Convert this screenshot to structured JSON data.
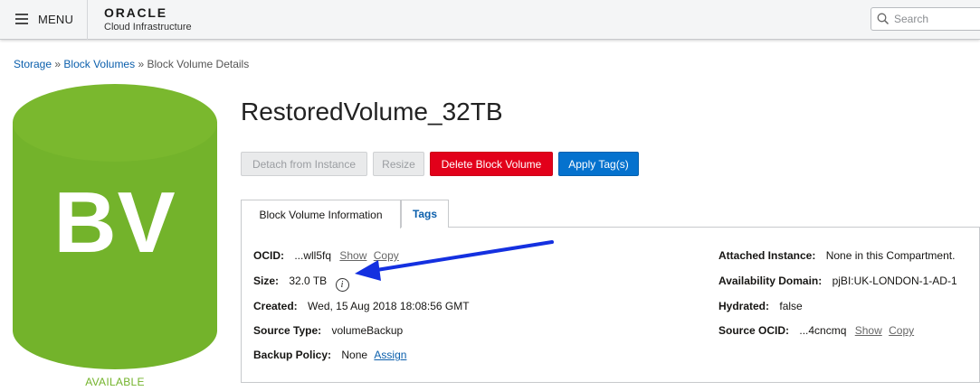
{
  "header": {
    "menu_label": "MENU",
    "brand": "ORACLE",
    "brand_sub": "Cloud Infrastructure",
    "search_placeholder": "Search"
  },
  "breadcrumb": {
    "items": [
      "Storage",
      "Block Volumes",
      "Block Volume Details"
    ],
    "separator": "»"
  },
  "resource": {
    "icon_text": "BV",
    "status": "AVAILABLE",
    "status_color": "#73b32b",
    "name": "RestoredVolume_32TB"
  },
  "actions": {
    "detach": "Detach from Instance",
    "resize": "Resize",
    "delete": "Delete Block Volume",
    "apply_tags": "Apply Tag(s)"
  },
  "tabs": {
    "info": "Block Volume Information",
    "tags": "Tags"
  },
  "details": {
    "ocid_label": "OCID:",
    "ocid_value": "...wll5fq",
    "show": "Show",
    "copy": "Copy",
    "size_label": "Size:",
    "size_value": "32.0 TB",
    "info_glyph": "i",
    "created_label": "Created:",
    "created_value": "Wed, 15 Aug 2018 18:08:56 GMT",
    "source_type_label": "Source Type:",
    "source_type_value": "volumeBackup",
    "backup_policy_label": "Backup Policy:",
    "backup_policy_value": "None",
    "assign": "Assign",
    "attached_label": "Attached Instance:",
    "attached_value": "None in this Compartment.",
    "ad_label": "Availability Domain:",
    "ad_value": "pjBI:UK-LONDON-1-AD-1",
    "hydrated_label": "Hydrated:",
    "hydrated_value": "false",
    "source_ocid_label": "Source OCID:",
    "source_ocid_value": "...4cncmq"
  },
  "colors": {
    "accent_blue": "#0572ce",
    "danger_red": "#e2001a",
    "volume_green": "#73b32b",
    "annotation_arrow": "#1430e0"
  },
  "icons": [
    "hamburger-icon",
    "search-icon",
    "info-icon",
    "annotation-arrow-icon"
  ]
}
